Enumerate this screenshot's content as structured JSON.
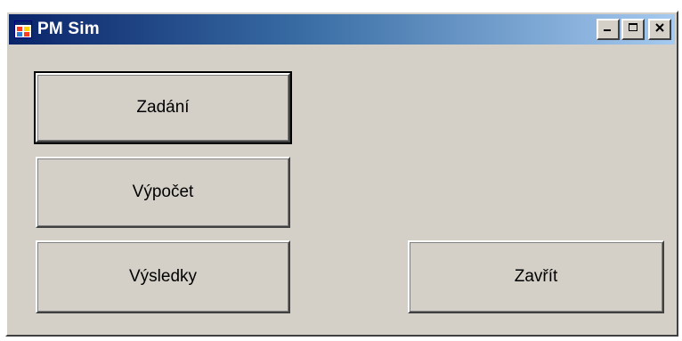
{
  "window": {
    "title": "PM Sim",
    "icon": "app-window-icon",
    "controls": {
      "minimize_icon": "minimize-icon",
      "maximize_icon": "maximize-icon",
      "close_icon": "close-icon"
    }
  },
  "buttons": {
    "zadani": "Zadání",
    "vypocet": "Výpočet",
    "vysledky": "Výsledky",
    "zavrit": "Zavřít"
  },
  "colors": {
    "face": "#d4d0c8",
    "title_start": "#0a246a",
    "title_end": "#a6caf0"
  }
}
